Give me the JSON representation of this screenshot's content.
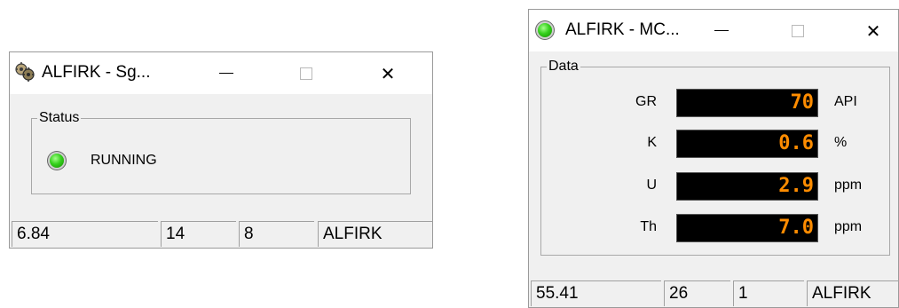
{
  "window_sg": {
    "title": "ALFIRK - Sg...",
    "status_group_label": "Status",
    "status_text": "RUNNING",
    "status_led_color": "#35d11d",
    "statusbar": [
      "6.84",
      "14",
      "8",
      "ALFIRK"
    ]
  },
  "window_mc": {
    "title": "ALFIRK - MC...",
    "title_led_color": "#35d11d",
    "data_group_label": "Data",
    "readout_color": "#ff8c00",
    "rows": [
      {
        "label": "GR",
        "value": "70",
        "unit": "API"
      },
      {
        "label": "K",
        "value": "0.6",
        "unit": "%"
      },
      {
        "label": "U",
        "value": "2.9",
        "unit": "ppm"
      },
      {
        "label": "Th",
        "value": "7.0",
        "unit": "ppm"
      }
    ],
    "statusbar": [
      "55.41",
      "26",
      "1",
      "ALFIRK"
    ]
  },
  "icons": [
    "gears-icon",
    "minimize-icon",
    "maximize-icon",
    "close-icon",
    "status-led-icon"
  ]
}
